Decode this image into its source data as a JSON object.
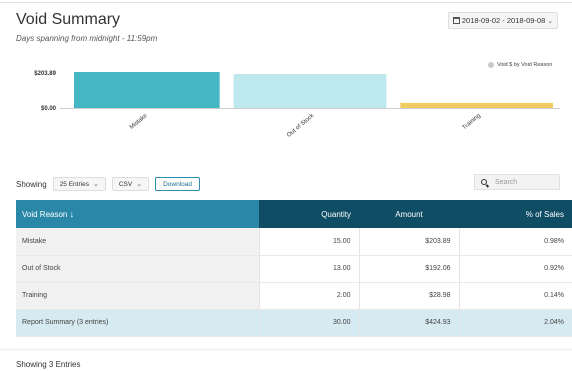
{
  "header": {
    "title": "Void Summary",
    "subtitle": "Days spanning from midnight - 11:59pm",
    "date_range": "2018-09-02 - 2018-09-08"
  },
  "chart_data": {
    "type": "bar",
    "categories": [
      "Mistake",
      "Out of Stock",
      "Training"
    ],
    "values": [
      203.89,
      192.06,
      28.98
    ],
    "colors": [
      "#45b6c3",
      "#bde8ed",
      "#f0cc62"
    ],
    "y_ticks": [
      "$0.00",
      "$203.89"
    ],
    "ylim": [
      0,
      203.89
    ],
    "legend": "Void $ by Void Reason",
    "legend_position": "top-right"
  },
  "controls": {
    "showing_label": "Showing",
    "entries_select": "25 Entries",
    "format_select": "CSV",
    "download_label": "Download",
    "search_placeholder": "Search"
  },
  "table": {
    "columns": [
      "Void Reason",
      "Quantity",
      "Amount",
      "% of Sales"
    ],
    "rows": [
      [
        "Mistake",
        "15.00",
        "$203.89",
        "0.98%"
      ],
      [
        "Out of Stock",
        "13.00",
        "$192.06",
        "0.92%"
      ],
      [
        "Training",
        "2.00",
        "$28.98",
        "0.14%"
      ]
    ],
    "summary": [
      "Report Summary (3 entries)",
      "30.00",
      "$424.93",
      "2.04%"
    ]
  },
  "footer": {
    "text": "Showing 3 Entries"
  }
}
